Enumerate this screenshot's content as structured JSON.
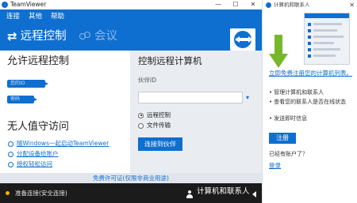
{
  "window": {
    "title": "TeamViewer",
    "controls": {
      "minimize": "—",
      "maximize": "☐",
      "close": "✕"
    }
  },
  "menu": [
    "连接",
    "其他",
    "帮助"
  ],
  "tabs": {
    "remote_control": {
      "label": "远程控制",
      "icon": "swap-arrows-icon",
      "active": true
    },
    "meeting": {
      "label": "会议",
      "icon": "people-icon",
      "active": false
    }
  },
  "left": {
    "allow_heading": "允许远程控制",
    "your_id_label": "您的ID",
    "password_label": "密码",
    "unattended_heading": "无人值守访问",
    "unattended_links": [
      "随Windows一起启动TeamViewer",
      "分配设备给账户",
      "授权轻松访问"
    ]
  },
  "right": {
    "control_heading": "控制远程计算机",
    "partner_label": "伙伴ID",
    "partner_value": "",
    "radio_options": [
      {
        "label": "远程控制",
        "checked": true
      },
      {
        "label": "文件传输",
        "checked": false
      }
    ],
    "connect_button": "连接到伙伴"
  },
  "license_text": "免费许可证(仅限非商业用途)",
  "status": {
    "text": "准备连接(安全连接)",
    "indicator_color": "#f0b400",
    "contacts_label": "计算机和联系人"
  },
  "side_panel": {
    "title": "计算机和联系人",
    "promo_link": "立即免费注册您的计算机列表。",
    "features": [
      "管理计算机和联系人",
      "查看您的联系人是否在线状态",
      "发送即时信息"
    ],
    "register_button": "注册",
    "have_account_text": "已经有账户了？",
    "login_link": "登录"
  },
  "colors": {
    "brand_blue": "#0e6fd0",
    "arrow_green": "#77b82a",
    "status_bar": "#1b1b1b"
  }
}
